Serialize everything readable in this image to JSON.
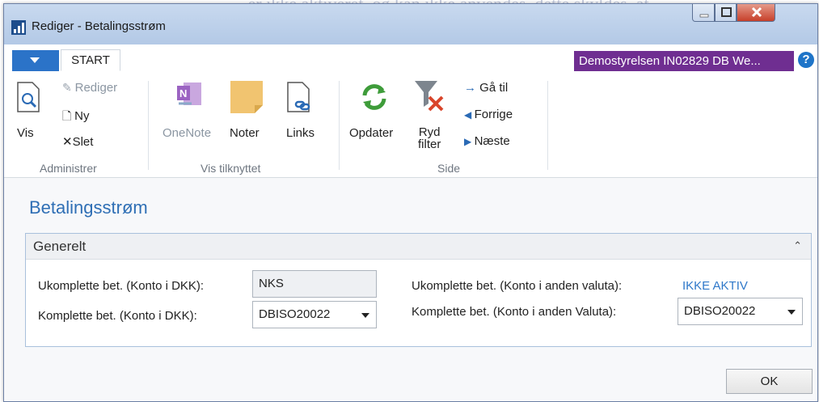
{
  "window": {
    "title": "Rediger - Betalingsstrøm"
  },
  "tabs": {
    "start": "START"
  },
  "company": "Demostyrelsen IN02829 DB We...",
  "ribbon": {
    "administrer": {
      "vis": "Vis",
      "rediger": "Rediger",
      "ny": "Ny",
      "slet": "Slet",
      "group": "Administrer"
    },
    "vis_tilknyttet": {
      "onenote": "OneNote",
      "noter": "Noter",
      "links": "Links",
      "group": "Vis tilknyttet"
    },
    "side": {
      "opdater": "Opdater",
      "ryd_filter_1": "Ryd",
      "ryd_filter_2": "filter",
      "gaa_til": "Gå til",
      "forrige": "Forrige",
      "naeste": "Næste",
      "group": "Side"
    }
  },
  "page": {
    "title": "Betalingsstrøm"
  },
  "generelt": {
    "title": "Generelt",
    "ukomplette_dkk_label": "Ukomplette bet. (Konto i DKK):",
    "ukomplette_dkk_value": "NKS",
    "komplette_dkk_label": "Komplette bet. (Konto i DKK):",
    "komplette_dkk_value": "DBISO20022",
    "ukomplette_valuta_label": "Ukomplette bet. (Konto i anden valuta):",
    "ukomplette_valuta_value": "IKKE AKTIV",
    "komplette_valuta_label": "Komplette bet. (Konto i anden Valuta):",
    "komplette_valuta_value": "DBISO20022"
  },
  "buttons": {
    "ok": "OK"
  },
  "background_text": "...er ikke aktiveret, og kan ikke anvendes, dette skyldes, at...",
  "colors": {
    "accent": "#2f6fb5",
    "company_badge": "#6f2e91",
    "app_menu": "#2b73c8"
  }
}
